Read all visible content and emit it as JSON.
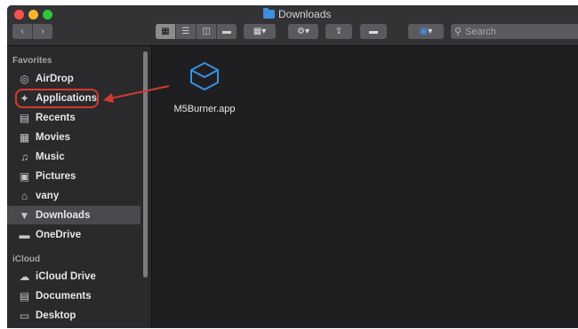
{
  "window": {
    "title": "Downloads"
  },
  "toolbar": {
    "back_icon": "chevron-left-icon",
    "forward_icon": "chevron-right-icon",
    "view_modes": [
      "icon-view",
      "list-view",
      "column-view",
      "gallery-view"
    ],
    "active_view": "icon-view",
    "search_placeholder": "Search"
  },
  "sidebar": {
    "favorites_label": "Favorites",
    "favorites": [
      {
        "label": "AirDrop",
        "icon": "airdrop-icon"
      },
      {
        "label": "Applications",
        "icon": "applications-icon",
        "highlighted": true
      },
      {
        "label": "Recents",
        "icon": "recents-icon"
      },
      {
        "label": "Movies",
        "icon": "movies-icon"
      },
      {
        "label": "Music",
        "icon": "music-icon"
      },
      {
        "label": "Pictures",
        "icon": "pictures-icon"
      },
      {
        "label": "vany",
        "icon": "home-icon"
      },
      {
        "label": "Downloads",
        "icon": "downloads-icon",
        "selected": true
      },
      {
        "label": "OneDrive",
        "icon": "folder-icon"
      }
    ],
    "icloud_label": "iCloud",
    "icloud": [
      {
        "label": "iCloud Drive",
        "icon": "cloud-icon"
      },
      {
        "label": "Documents",
        "icon": "documents-icon"
      },
      {
        "label": "Desktop",
        "icon": "desktop-icon"
      }
    ]
  },
  "content": {
    "files": [
      {
        "name": "M5Burner.app",
        "icon": "app-box-icon"
      }
    ]
  },
  "colors": {
    "accent": "#3d8fe0",
    "annotation": "#d43a2f"
  }
}
